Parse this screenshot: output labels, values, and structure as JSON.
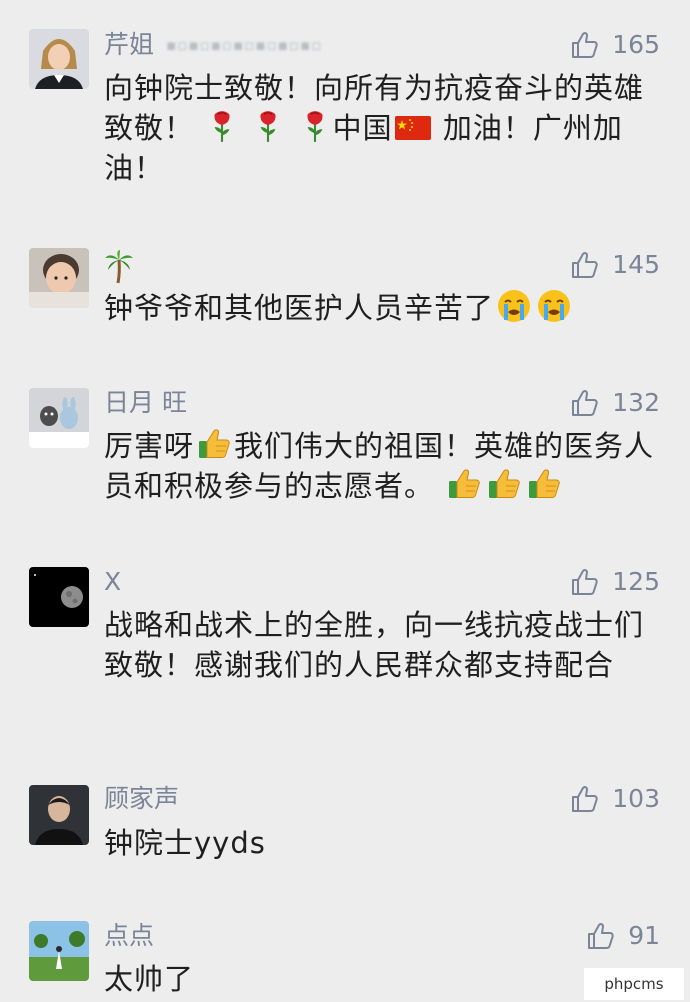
{
  "comments": [
    {
      "name": "芹姐",
      "likes": "165",
      "text_parts": [
        "向钟院士致敬！向所有为抗疫奋斗的英雄致敬！",
        "中国",
        "加油！广州加油！"
      ]
    },
    {
      "name": "",
      "likes": "145",
      "text": "钟爷爷和其他医护人员辛苦了"
    },
    {
      "name": "日月 旺",
      "likes": "132",
      "text_parts": [
        "厉害呀",
        "我们伟大的祖国！英雄的医务人员和积极参与的志愿者。"
      ]
    },
    {
      "name": "X",
      "likes": "125",
      "text": "战略和战术上的全胜，向一线抗疫战士们致敬！感谢我们的人民群众都支持配合"
    },
    {
      "name": "顾家声",
      "likes": "103",
      "text": "钟院士yyds"
    },
    {
      "name": "点点",
      "likes": "91",
      "text": "太帅了"
    }
  ],
  "watermark": "phpcms",
  "icons": {
    "like": "thumbs-up-outline-icon",
    "rose": "rose-emoji",
    "flag": "china-flag-emoji",
    "palm": "palm-tree-emoji",
    "cry": "crying-face-emoji",
    "thumb": "thumbs-up-emoji"
  }
}
